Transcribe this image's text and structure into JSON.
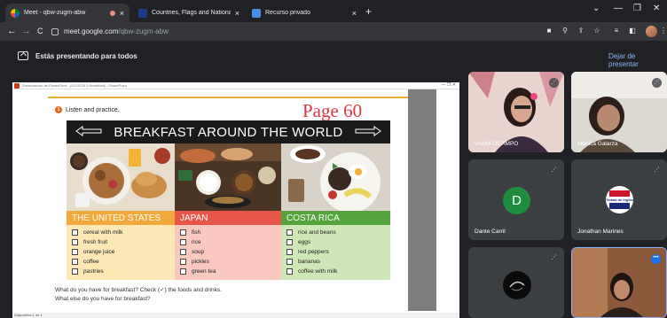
{
  "browser": {
    "tabs": [
      {
        "title": "Meet - qbw-zugm-abw",
        "close": "×"
      },
      {
        "title": "Countries, Flags and Nationaliti",
        "close": "×"
      },
      {
        "title": "Recurso privado",
        "close": "×"
      }
    ],
    "new_tab": "+",
    "window_controls": [
      "⌄",
      "—",
      "❐",
      "✕"
    ],
    "nav": {
      "back": "←",
      "forward": "→",
      "reload": "C"
    },
    "address": {
      "host": "meet.google.com",
      "path": "/qbw-zugm-abw"
    },
    "toolbar_icons": [
      "■",
      "⚲",
      "⇪",
      "☆",
      "≡",
      "◧",
      "⋮"
    ]
  },
  "meet": {
    "presenting_text": "Estás presentando para todos",
    "stop_button": "Dejar de presentar"
  },
  "powerpoint": {
    "window_title": "Presentación de PowerPoint - [LESSON 5 Breakfast] - PowerPoint",
    "window_controls": "— ❐ ✕",
    "status_left": "Diapositiva 1 de 1"
  },
  "slide": {
    "instruction": "Listen and practice.",
    "instruction_num": "1",
    "page": "Page 60",
    "banner": "BREAKFAST AROUND THE WORLD",
    "columns": [
      {
        "country": "THE UNITED STATES",
        "color": "#f2a93b",
        "bg": "#fbe8b5",
        "items": [
          "cereal with milk",
          "fresh fruit",
          "orange juice",
          "coffee",
          "pastries"
        ]
      },
      {
        "country": "JAPAN",
        "color": "#e8564a",
        "bg": "#f9c9bf",
        "items": [
          "fish",
          "rice",
          "soup",
          "pickles",
          "green tea"
        ]
      },
      {
        "country": "COSTA RICA",
        "color": "#55a33c",
        "bg": "#cfe6b6",
        "items": [
          "rice and beans",
          "eggs",
          "red peppers",
          "bananas",
          "coffee with milk"
        ]
      }
    ],
    "question_1": "What do you have for breakfast? Check (✓) the foods and drinks.",
    "question_2": "What else do you have for breakfast?"
  },
  "participants": [
    {
      "name": "VANIA OCAMPO",
      "type": "video",
      "mic": "⋰"
    },
    {
      "name": "Mónica Galarza",
      "type": "video",
      "mic": "⋰"
    },
    {
      "name": "Dante Carril",
      "type": "initial",
      "initial": "D",
      "color": "#1e8e3e",
      "mic": "⋰"
    },
    {
      "name": "Jonathan Marines",
      "type": "logo",
      "logo_text": "Temas de Inglés",
      "mic": "⋰"
    },
    {
      "name": "",
      "type": "dark-logo",
      "mic": "⋰"
    },
    {
      "name": "",
      "type": "video",
      "more": "•••"
    }
  ]
}
